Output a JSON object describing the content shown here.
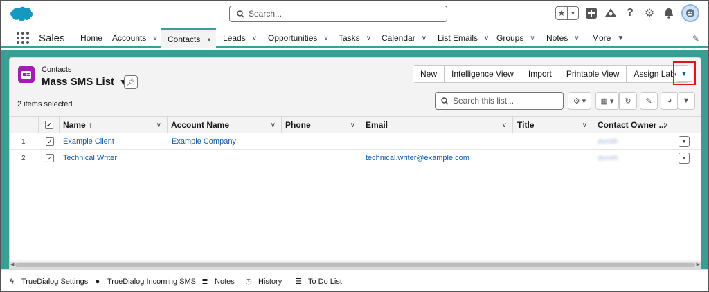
{
  "header": {
    "search_placeholder": "Search...",
    "icons": [
      "salesforce-cloud-logo",
      "star-icon",
      "add-icon",
      "trailhead-icon",
      "help-icon",
      "setup-gear-icon",
      "notification-bell-icon",
      "avatar"
    ]
  },
  "nav": {
    "app_name": "Sales",
    "items": [
      {
        "label": "Home",
        "has_menu": false,
        "active": false
      },
      {
        "label": "Accounts",
        "has_menu": true,
        "active": false
      },
      {
        "label": "Contacts",
        "has_menu": true,
        "active": true
      },
      {
        "label": "Leads",
        "has_menu": true,
        "active": false
      },
      {
        "label": "Opportunities",
        "has_menu": true,
        "active": false
      },
      {
        "label": "Tasks",
        "has_menu": true,
        "active": false
      },
      {
        "label": "Calendar",
        "has_menu": true,
        "active": false
      },
      {
        "label": "List Emails",
        "has_menu": true,
        "active": false
      },
      {
        "label": "Groups",
        "has_menu": true,
        "active": false
      },
      {
        "label": "Notes",
        "has_menu": true,
        "active": false
      },
      {
        "label": "More",
        "has_menu": true,
        "active": false
      }
    ]
  },
  "list_view": {
    "object_label": "Contacts",
    "title": "Mass SMS List",
    "items_selected": "2 items selected",
    "actions": [
      "New",
      "Intelligence View",
      "Import",
      "Printable View",
      "Assign Label"
    ],
    "search_placeholder": "Search this list..."
  },
  "table": {
    "columns": [
      "Name",
      "Account Name",
      "Phone",
      "Email",
      "Title",
      "Contact Owner ..."
    ],
    "sort_indicator": "↑",
    "rows": [
      {
        "num": "1",
        "name": "Example Client",
        "account": "Example Company",
        "phone": "",
        "email": "",
        "title": "",
        "owner": "dsmith"
      },
      {
        "num": "2",
        "name": "Technical Writer",
        "account": "",
        "phone": "",
        "email": "technical.writer@example.com",
        "title": "",
        "owner": "dsmith"
      }
    ]
  },
  "utility_bar": {
    "items": [
      "TrueDialog Settings",
      "TrueDialog Incoming SMS",
      "Notes",
      "History",
      "To Do List"
    ]
  },
  "colors": {
    "brand_blue": "#0b5cab",
    "accent_teal": "#3c9d94",
    "object_icon_purple": "#a11eb1",
    "highlight_red": "#e0151b"
  }
}
